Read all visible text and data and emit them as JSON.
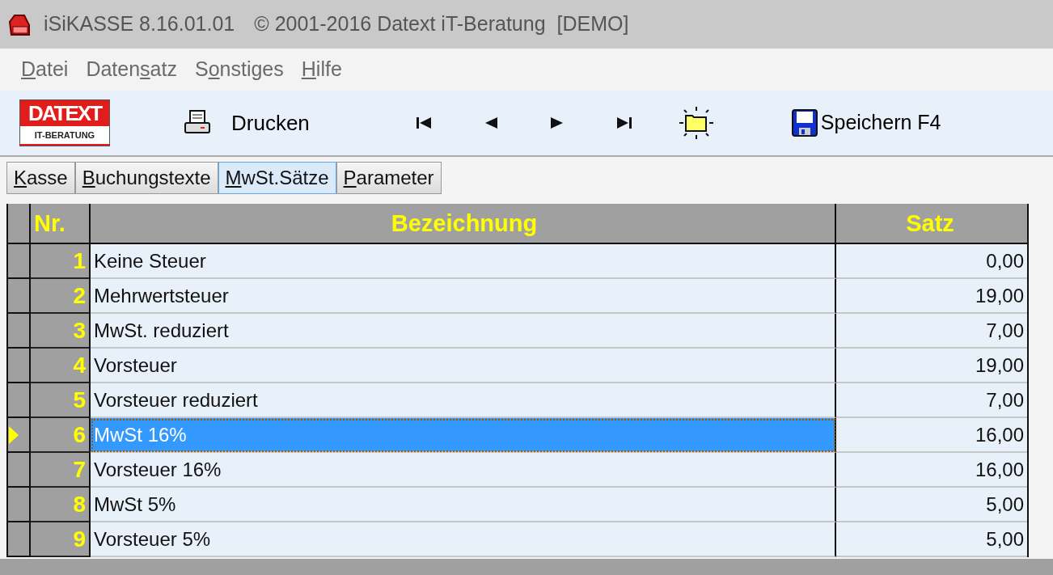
{
  "window": {
    "title": "iSiKASSE 8.16.01.01",
    "copyright": "© 2001-2016 Datext iT-Beratung  [DEMO]"
  },
  "menu": [
    {
      "parts": {
        "key": "D",
        "post": "atei"
      }
    },
    {
      "parts": {
        "pre": "Daten",
        "key": "s",
        "post": "atz"
      }
    },
    {
      "parts": {
        "pre": "S",
        "key": "o",
        "post": "nstiges"
      }
    },
    {
      "parts": {
        "key": "H",
        "post": "ilfe"
      }
    }
  ],
  "toolbar": {
    "logo_top": "DATEXT",
    "logo_bottom": "IT-BERATUNG",
    "print_label": "Drucken",
    "nav": [
      {
        "kind": "first"
      },
      {
        "kind": "prev"
      },
      {
        "kind": "next"
      },
      {
        "kind": "last"
      },
      {
        "kind": "new"
      }
    ],
    "save_label": "Speichern F4"
  },
  "tabs": [
    {
      "parts": {
        "key": "K",
        "post": "asse"
      },
      "selected": false
    },
    {
      "parts": {
        "key": "B",
        "post": "uchungstexte"
      },
      "selected": false
    },
    {
      "parts": {
        "key": "M",
        "post": "wSt.Sätze"
      },
      "selected": true
    },
    {
      "parts": {
        "key": "P",
        "post": "arameter"
      },
      "selected": false
    }
  ],
  "table": {
    "columns": [
      "Nr.",
      "Bezeichnung",
      "Satz"
    ],
    "rows": [
      {
        "nr": "1",
        "name": "Keine Steuer",
        "rate": "0,00",
        "selected": false
      },
      {
        "nr": "2",
        "name": "Mehrwertsteuer",
        "rate": "19,00",
        "selected": false
      },
      {
        "nr": "3",
        "name": "MwSt. reduziert",
        "rate": "7,00",
        "selected": false
      },
      {
        "nr": "4",
        "name": "Vorsteuer",
        "rate": "19,00",
        "selected": false
      },
      {
        "nr": "5",
        "name": "Vorsteuer reduziert",
        "rate": "7,00",
        "selected": false
      },
      {
        "nr": "6",
        "name": "MwSt 16%",
        "rate": "16,00",
        "selected": true
      },
      {
        "nr": "7",
        "name": "Vorsteuer 16%",
        "rate": "16,00",
        "selected": false
      },
      {
        "nr": "8",
        "name": "MwSt 5%",
        "rate": "5,00",
        "selected": false
      },
      {
        "nr": "9",
        "name": "Vorsteuer 5%",
        "rate": "5,00",
        "selected": false
      }
    ]
  }
}
